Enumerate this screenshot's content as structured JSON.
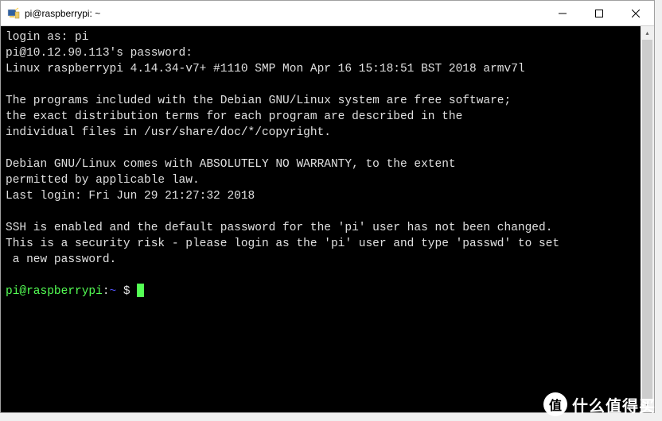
{
  "titlebar": {
    "title": "pi@raspberrypi: ~"
  },
  "terminal": {
    "login_prompt": "login as: pi",
    "password_prompt": "pi@10.12.90.113's password:",
    "kernel_line": "Linux raspberrypi 4.14.34-v7+ #1110 SMP Mon Apr 16 15:18:51 BST 2018 armv7l",
    "motd_line1": "The programs included with the Debian GNU/Linux system are free software;",
    "motd_line2": "the exact distribution terms for each program are described in the",
    "motd_line3": "individual files in /usr/share/doc/*/copyright.",
    "warranty_line1": "Debian GNU/Linux comes with ABSOLUTELY NO WARRANTY, to the extent",
    "warranty_line2": "permitted by applicable law.",
    "last_login": "Last login: Fri Jun 29 21:27:32 2018",
    "ssh_warn1": "SSH is enabled and the default password for the 'pi' user has not been changed.",
    "ssh_warn2": "This is a security risk - please login as the 'pi' user and type 'passwd' to set",
    "ssh_warn3": " a new password.",
    "prompt_user": "pi@raspberrypi",
    "prompt_colon": ":",
    "prompt_path": "~",
    "prompt_dollar": " $ "
  },
  "watermark": {
    "circle": "值",
    "text": "什么值得买"
  }
}
